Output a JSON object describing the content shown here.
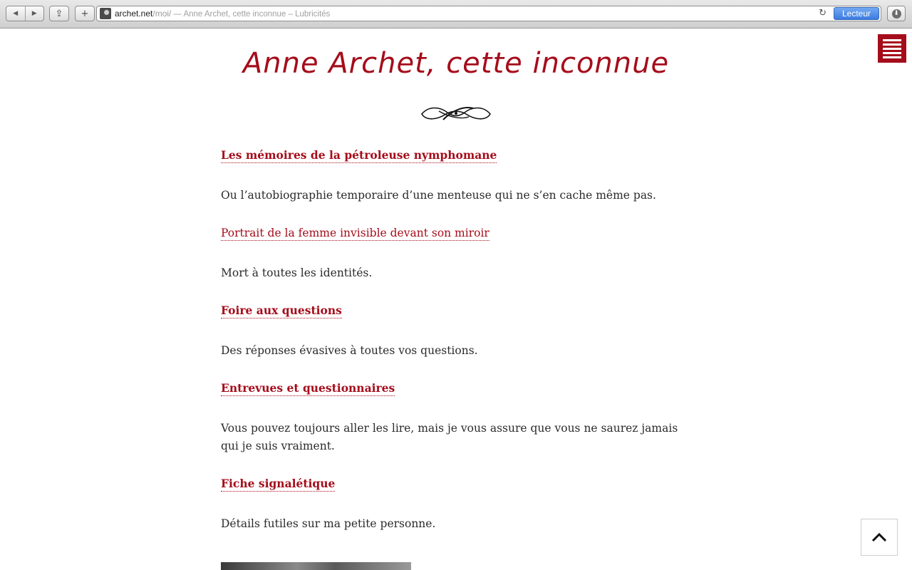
{
  "browser": {
    "url_domain": "archet.net",
    "url_path": "/moi/",
    "page_title": "— Anne Archet, cette inconnue – Lubricités",
    "reader_label": "Lecteur",
    "back_glyph": "◀",
    "forward_glyph": "▶",
    "share_glyph": "⇪",
    "new_tab_glyph": "+",
    "reload_glyph": "↻",
    "download_glyph": "⬇"
  },
  "page": {
    "title": "Anne Archet, cette inconnue",
    "accent_color": "#a50d1b",
    "entries": [
      {
        "title": "Les mémoires de la pétroleuse nymphomane",
        "bold": true,
        "description": "Ou l’autobiographie temporaire d’une menteuse qui ne s’en cache même pas."
      },
      {
        "title": "Portrait de la femme invisible devant son miroir",
        "bold": false,
        "description": "Mort à toutes les identités."
      },
      {
        "title": "Foire aux questions",
        "bold": true,
        "description": "Des réponses évasives à toutes vos questions."
      },
      {
        "title": "Entrevues et questionnaires",
        "bold": true,
        "description": "Vous pouvez toujours aller les lire, mais je vous assure que vous ne saurez jamais qui je suis vraiment."
      },
      {
        "title": "Fiche signalétique",
        "bold": true,
        "description": "Détails futiles sur ma petite personne."
      }
    ]
  }
}
